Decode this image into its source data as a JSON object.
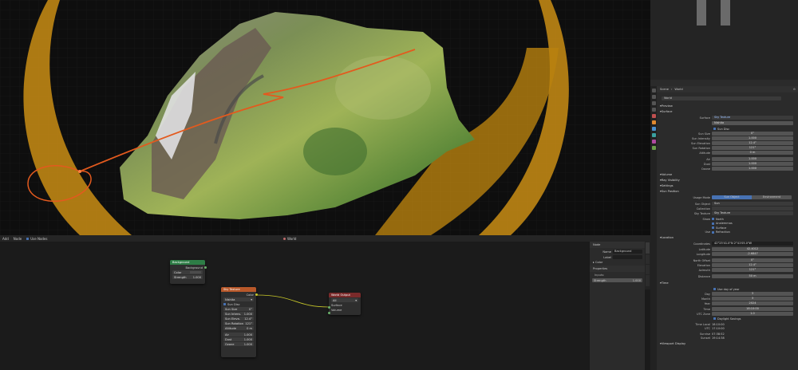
{
  "viewport": {
    "bg": "#0e0e0e",
    "ring_color": "#e0a11a",
    "path_color": "#e35a1e"
  },
  "node_editor": {
    "header": {
      "add": "Add",
      "node": "Node",
      "use_nodes_label": "Use Nodes",
      "world_name": "World"
    },
    "background": {
      "title": "Background",
      "output": "Background",
      "color": "Color",
      "strength_label": "Strength",
      "strength_value": "1.000"
    },
    "sky": {
      "title": "Sky Texture",
      "output": "Color",
      "type": "Nishita",
      "sun_disc": "Sun Disc",
      "rows": [
        {
          "label": "Sun Size",
          "value": "0°"
        },
        {
          "label": "Sun Intens.",
          "value": "1.000"
        },
        {
          "label": "Sun Eleva.",
          "value": "12.4°"
        },
        {
          "label": "Sun Rotation",
          "value": "121°"
        },
        {
          "label": "Altitude",
          "value": "0 m"
        },
        {
          "label": "Air",
          "value": "1.000"
        },
        {
          "label": "Dust",
          "value": "1.000"
        },
        {
          "label": "Ozone",
          "value": "1.000"
        }
      ]
    },
    "world_output": {
      "title": "World Output",
      "target": "All",
      "surface": "Surface",
      "volume": "Volume"
    },
    "npanel": {
      "node_header": "Node",
      "name_label": "Name",
      "name_value": "Background",
      "label_label": "Label",
      "color_label": "Color",
      "properties": "Properties",
      "inputs": "Inputs:",
      "strength_label": "Strength",
      "strength_value": "1.000",
      "tabs": [
        "Node",
        "Tool",
        "View",
        "Options"
      ]
    }
  },
  "properties": {
    "breadcrumb": [
      "Scene",
      "World"
    ],
    "world_name": "World",
    "sections": {
      "preview": "Preview",
      "surface": "Surface",
      "volume": "Volume",
      "ray_visibility": "Ray Visibility",
      "settings": "Settings",
      "sun_position": "Sun Position",
      "location": "Location",
      "time": "Time",
      "viewport_display": "Viewport Display"
    },
    "surface_label": "Surface",
    "surface_value": "Sky Texture",
    "sky_type": "Nishita",
    "sun_disc": "Sun Disc",
    "sky_rows": [
      {
        "label": "Sun Size",
        "value": "0°"
      },
      {
        "label": "Sun Intensity",
        "value": "1.000"
      },
      {
        "label": "Sun Elevation",
        "value": "12.4°"
      },
      {
        "label": "Sun Rotation",
        "value": "121°"
      },
      {
        "label": "Altitude",
        "value": "0 m"
      }
    ],
    "sky_rows2": [
      {
        "label": "Air",
        "value": "1.000"
      },
      {
        "label": "Dust",
        "value": "1.000"
      },
      {
        "label": "Ozone",
        "value": "1.000"
      }
    ],
    "usage_mode": {
      "label": "Usage Mode",
      "options": [
        "Sun Object",
        "Environment"
      ]
    },
    "sun_object": {
      "label": "Sun Object",
      "value": "Sun"
    },
    "collection": {
      "label": "Collection",
      "placeholder": ""
    },
    "sky_texture": {
      "label": "Sky Texture",
      "value": "Sky Texture"
    },
    "show_label": "Show",
    "show_options": [
      "North",
      "Analemmas",
      "Surface",
      "Refraction"
    ],
    "use_label": "Use",
    "coordinates": {
      "label": "Coordinates",
      "value": "42°23'41.0\"N 2°41'05.0\"W"
    },
    "location_rows": [
      {
        "label": "Latitude",
        "value": "42.4012"
      },
      {
        "label": "Longitude",
        "value": "-2.6847"
      },
      {
        "label": "North Offset",
        "value": "0°"
      },
      {
        "label": "Elevation",
        "value": "12.4°"
      },
      {
        "label": "Azimuth",
        "value": "121°"
      },
      {
        "label": "Distance",
        "value": "50 m"
      }
    ],
    "use_day_of_year": "Use day of year",
    "time_rows": [
      {
        "label": "Day",
        "value": "3"
      },
      {
        "label": "Month",
        "value": "3"
      },
      {
        "label": "Year",
        "value": "2024"
      },
      {
        "label": "Time",
        "value": "18:10:00"
      },
      {
        "label": "UTC Zone",
        "value": "1.0"
      }
    ],
    "daylight_savings": "Daylight Savings",
    "time_info": [
      {
        "label": "Time Local",
        "value": "18:10:00"
      },
      {
        "label": "UTC",
        "value": "17:10:00"
      },
      {
        "label": "Sunrise",
        "value": "07:38:52"
      },
      {
        "label": "Sunset",
        "value": "19:14:38"
      }
    ]
  }
}
